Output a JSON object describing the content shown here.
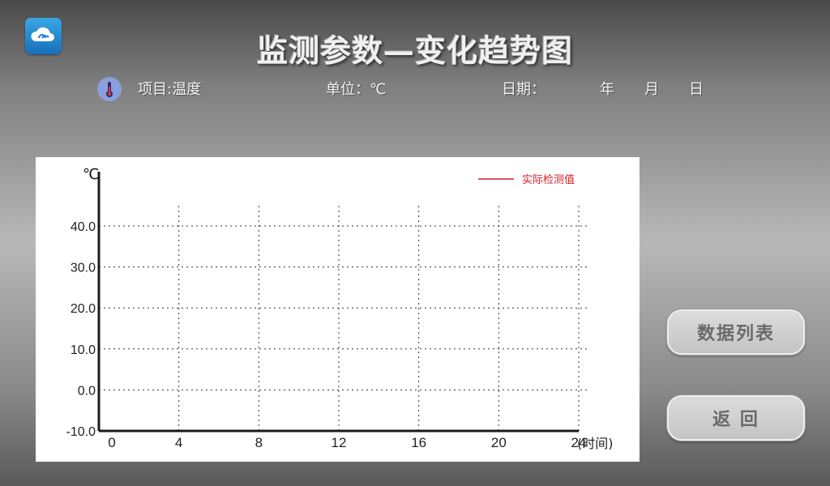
{
  "header": {
    "title": "监测参数—变化趋势图",
    "item_label": "项目:温度",
    "unit_label": "单位：℃",
    "date_label": "日期：",
    "year": "年",
    "month": "月",
    "day": "日"
  },
  "icons": {
    "app": "cloud-icon",
    "item": "thermometer-icon"
  },
  "buttons": {
    "data_list": "数据列表",
    "back": "返 回"
  },
  "colors": {
    "series_line": "#d2202e",
    "axis": "#1a1a1a"
  },
  "chart_data": {
    "type": "line",
    "title": "",
    "ylabel": "℃",
    "xlabel": "(时间)",
    "x_ticks": [
      0,
      4,
      8,
      12,
      16,
      20,
      24
    ],
    "y_ticks": [
      "40.0",
      "30.0",
      "20.0",
      "10.0",
      "0.0",
      "-10.0"
    ],
    "xlim": [
      0,
      24
    ],
    "ylim": [
      -10,
      40
    ],
    "grid": true,
    "legend_position": "top-right",
    "series": [
      {
        "name": "实际检测值",
        "x": [],
        "y": []
      }
    ]
  }
}
